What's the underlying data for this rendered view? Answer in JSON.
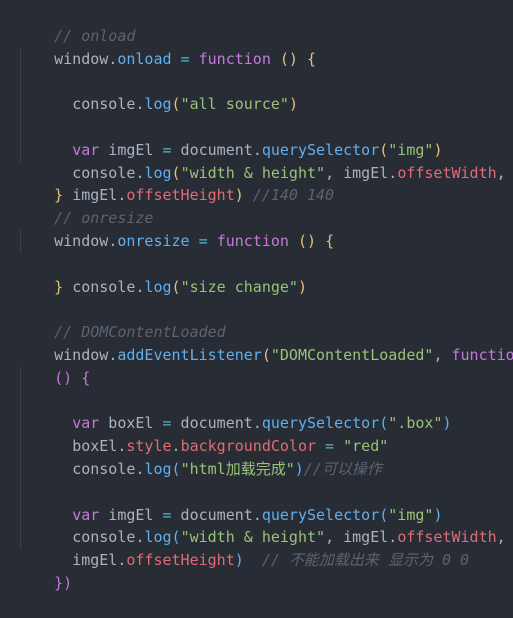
{
  "code": {
    "l1": "// onload",
    "l2_window": "window",
    "l2_dot": ".",
    "l2_onload": "onload",
    "l2_eq": " = ",
    "l2_function": "function",
    "l2_parens": " () ",
    "l2_brace": "{",
    "l3_console": "console",
    "l3_dot": ".",
    "l3_log": "log",
    "l3_open": "(",
    "l3_str": "\"all source\"",
    "l3_close": ")",
    "l5_var": "var",
    "l5_name": " imgEl ",
    "l5_eq": "=",
    "l5_document": " document",
    "l5_dot": ".",
    "l5_qs": "querySelector",
    "l5_open": "(",
    "l5_str": "\"img\"",
    "l5_close": ")",
    "l6_console": "console",
    "l6_dot": ".",
    "l6_log": "log",
    "l6_open": "(",
    "l6_str": "\"width & height\"",
    "l6_comma": ", ",
    "l6_img": "imgEl",
    "l6_dot2": ".",
    "l6_offw": "offsetWidth",
    "l6_comma2": ",",
    "l7_img": "imgEl",
    "l7_dot": ".",
    "l7_offh": "offsetHeight",
    "l7_close": ")",
    "l7_comment": " //140 140",
    "l8_brace": "}",
    "l9": "// onresize",
    "l10_window": "window",
    "l10_dot": ".",
    "l10_onresize": "onresize",
    "l10_eq": " = ",
    "l10_function": "function",
    "l10_parens": " () ",
    "l10_brace": "{",
    "l11_console": "console",
    "l11_dot": ".",
    "l11_log": "log",
    "l11_open": "(",
    "l11_str": "\"size change\"",
    "l11_close": ")",
    "l12_brace": "}",
    "l14": "// DOMContentLoaded",
    "l15_window": "window",
    "l15_dot": ".",
    "l15_ael": "addEventListener",
    "l15_open": "(",
    "l15_str": "\"DOMContentLoaded\"",
    "l15_comma": ", ",
    "l15_function": "function",
    "l16_parens": "() ",
    "l16_brace": "{",
    "l17_var": "var",
    "l17_name": " boxEl ",
    "l17_eq": "=",
    "l17_document": " document",
    "l17_dot": ".",
    "l17_qs": "querySelector",
    "l17_open": "(",
    "l17_str": "\".box\"",
    "l17_close": ")",
    "l18_box": "boxEl",
    "l18_dot": ".",
    "l18_style": "style",
    "l18_dot2": ".",
    "l18_bg": "backgroundColor",
    "l18_eq": " = ",
    "l18_str": "\"red\"",
    "l19_console": "console",
    "l19_dot": ".",
    "l19_log": "log",
    "l19_open": "(",
    "l19_str": "\"html加载完成\"",
    "l19_close": ")",
    "l19_comment": "//可以操作",
    "l21_var": "var",
    "l21_name": " imgEl ",
    "l21_eq": "=",
    "l21_document": " document",
    "l21_dot": ".",
    "l21_qs": "querySelector",
    "l21_open": "(",
    "l21_str": "\"img\"",
    "l21_close": ")",
    "l22_console": "console",
    "l22_dot": ".",
    "l22_log": "log",
    "l22_open": "(",
    "l22_str": "\"width & height\"",
    "l22_comma": ", ",
    "l22_img": "imgEl",
    "l22_dot2": ".",
    "l22_offw": "offsetWidth",
    "l22_comma2": ",",
    "l23_img": "imgEl",
    "l23_dot": ".",
    "l23_offh": "offsetHeight",
    "l23_close": ")",
    "l23_comment": "  // 不能加载出来 显示为 0 0",
    "l25_close": "})"
  },
  "colors": {
    "background": "#282c34",
    "comment": "#5c6370",
    "keyword": "#c678dd",
    "string": "#98c379",
    "function": "#61afef",
    "property": "#e06c75",
    "operator": "#56b6c2"
  }
}
